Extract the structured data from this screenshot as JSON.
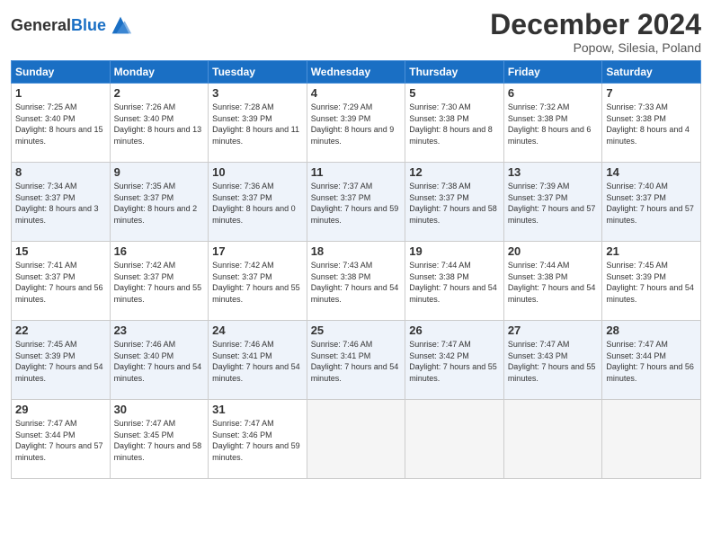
{
  "header": {
    "logo_general": "General",
    "logo_blue": "Blue",
    "month": "December 2024",
    "location": "Popow, Silesia, Poland"
  },
  "columns": [
    "Sunday",
    "Monday",
    "Tuesday",
    "Wednesday",
    "Thursday",
    "Friday",
    "Saturday"
  ],
  "weeks": [
    [
      {
        "day": "1",
        "sunrise": "Sunrise: 7:25 AM",
        "sunset": "Sunset: 3:40 PM",
        "daylight": "Daylight: 8 hours and 15 minutes."
      },
      {
        "day": "2",
        "sunrise": "Sunrise: 7:26 AM",
        "sunset": "Sunset: 3:40 PM",
        "daylight": "Daylight: 8 hours and 13 minutes."
      },
      {
        "day": "3",
        "sunrise": "Sunrise: 7:28 AM",
        "sunset": "Sunset: 3:39 PM",
        "daylight": "Daylight: 8 hours and 11 minutes."
      },
      {
        "day": "4",
        "sunrise": "Sunrise: 7:29 AM",
        "sunset": "Sunset: 3:39 PM",
        "daylight": "Daylight: 8 hours and 9 minutes."
      },
      {
        "day": "5",
        "sunrise": "Sunrise: 7:30 AM",
        "sunset": "Sunset: 3:38 PM",
        "daylight": "Daylight: 8 hours and 8 minutes."
      },
      {
        "day": "6",
        "sunrise": "Sunrise: 7:32 AM",
        "sunset": "Sunset: 3:38 PM",
        "daylight": "Daylight: 8 hours and 6 minutes."
      },
      {
        "day": "7",
        "sunrise": "Sunrise: 7:33 AM",
        "sunset": "Sunset: 3:38 PM",
        "daylight": "Daylight: 8 hours and 4 minutes."
      }
    ],
    [
      {
        "day": "8",
        "sunrise": "Sunrise: 7:34 AM",
        "sunset": "Sunset: 3:37 PM",
        "daylight": "Daylight: 8 hours and 3 minutes."
      },
      {
        "day": "9",
        "sunrise": "Sunrise: 7:35 AM",
        "sunset": "Sunset: 3:37 PM",
        "daylight": "Daylight: 8 hours and 2 minutes."
      },
      {
        "day": "10",
        "sunrise": "Sunrise: 7:36 AM",
        "sunset": "Sunset: 3:37 PM",
        "daylight": "Daylight: 8 hours and 0 minutes."
      },
      {
        "day": "11",
        "sunrise": "Sunrise: 7:37 AM",
        "sunset": "Sunset: 3:37 PM",
        "daylight": "Daylight: 7 hours and 59 minutes."
      },
      {
        "day": "12",
        "sunrise": "Sunrise: 7:38 AM",
        "sunset": "Sunset: 3:37 PM",
        "daylight": "Daylight: 7 hours and 58 minutes."
      },
      {
        "day": "13",
        "sunrise": "Sunrise: 7:39 AM",
        "sunset": "Sunset: 3:37 PM",
        "daylight": "Daylight: 7 hours and 57 minutes."
      },
      {
        "day": "14",
        "sunrise": "Sunrise: 7:40 AM",
        "sunset": "Sunset: 3:37 PM",
        "daylight": "Daylight: 7 hours and 57 minutes."
      }
    ],
    [
      {
        "day": "15",
        "sunrise": "Sunrise: 7:41 AM",
        "sunset": "Sunset: 3:37 PM",
        "daylight": "Daylight: 7 hours and 56 minutes."
      },
      {
        "day": "16",
        "sunrise": "Sunrise: 7:42 AM",
        "sunset": "Sunset: 3:37 PM",
        "daylight": "Daylight: 7 hours and 55 minutes."
      },
      {
        "day": "17",
        "sunrise": "Sunrise: 7:42 AM",
        "sunset": "Sunset: 3:37 PM",
        "daylight": "Daylight: 7 hours and 55 minutes."
      },
      {
        "day": "18",
        "sunrise": "Sunrise: 7:43 AM",
        "sunset": "Sunset: 3:38 PM",
        "daylight": "Daylight: 7 hours and 54 minutes."
      },
      {
        "day": "19",
        "sunrise": "Sunrise: 7:44 AM",
        "sunset": "Sunset: 3:38 PM",
        "daylight": "Daylight: 7 hours and 54 minutes."
      },
      {
        "day": "20",
        "sunrise": "Sunrise: 7:44 AM",
        "sunset": "Sunset: 3:38 PM",
        "daylight": "Daylight: 7 hours and 54 minutes."
      },
      {
        "day": "21",
        "sunrise": "Sunrise: 7:45 AM",
        "sunset": "Sunset: 3:39 PM",
        "daylight": "Daylight: 7 hours and 54 minutes."
      }
    ],
    [
      {
        "day": "22",
        "sunrise": "Sunrise: 7:45 AM",
        "sunset": "Sunset: 3:39 PM",
        "daylight": "Daylight: 7 hours and 54 minutes."
      },
      {
        "day": "23",
        "sunrise": "Sunrise: 7:46 AM",
        "sunset": "Sunset: 3:40 PM",
        "daylight": "Daylight: 7 hours and 54 minutes."
      },
      {
        "day": "24",
        "sunrise": "Sunrise: 7:46 AM",
        "sunset": "Sunset: 3:41 PM",
        "daylight": "Daylight: 7 hours and 54 minutes."
      },
      {
        "day": "25",
        "sunrise": "Sunrise: 7:46 AM",
        "sunset": "Sunset: 3:41 PM",
        "daylight": "Daylight: 7 hours and 54 minutes."
      },
      {
        "day": "26",
        "sunrise": "Sunrise: 7:47 AM",
        "sunset": "Sunset: 3:42 PM",
        "daylight": "Daylight: 7 hours and 55 minutes."
      },
      {
        "day": "27",
        "sunrise": "Sunrise: 7:47 AM",
        "sunset": "Sunset: 3:43 PM",
        "daylight": "Daylight: 7 hours and 55 minutes."
      },
      {
        "day": "28",
        "sunrise": "Sunrise: 7:47 AM",
        "sunset": "Sunset: 3:44 PM",
        "daylight": "Daylight: 7 hours and 56 minutes."
      }
    ],
    [
      {
        "day": "29",
        "sunrise": "Sunrise: 7:47 AM",
        "sunset": "Sunset: 3:44 PM",
        "daylight": "Daylight: 7 hours and 57 minutes."
      },
      {
        "day": "30",
        "sunrise": "Sunrise: 7:47 AM",
        "sunset": "Sunset: 3:45 PM",
        "daylight": "Daylight: 7 hours and 58 minutes."
      },
      {
        "day": "31",
        "sunrise": "Sunrise: 7:47 AM",
        "sunset": "Sunset: 3:46 PM",
        "daylight": "Daylight: 7 hours and 59 minutes."
      },
      null,
      null,
      null,
      null
    ]
  ]
}
